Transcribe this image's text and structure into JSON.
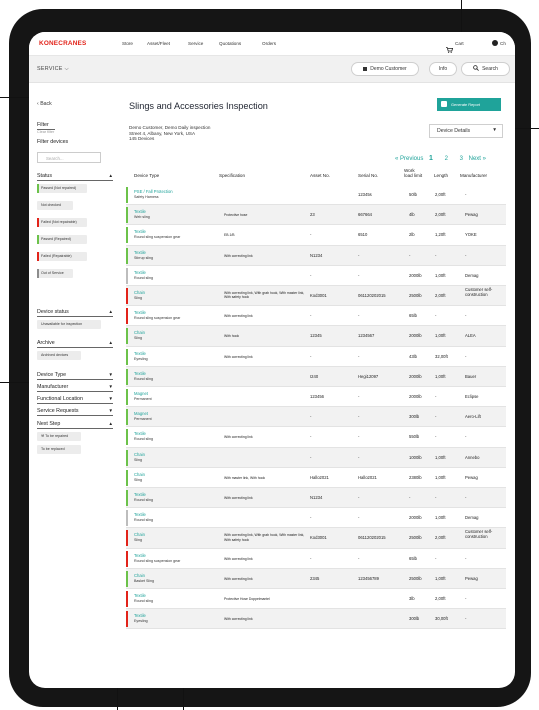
{
  "nav": {
    "logo": "KONECRANES",
    "items": [
      "Store",
      "Asset/Fleet",
      "Service",
      "Quotations",
      "Orders"
    ],
    "cart": "Cart",
    "user": "Ch"
  },
  "subbar": {
    "section": "SERVICE",
    "customer": "Demo Customer",
    "info": "Info",
    "search": "Search"
  },
  "sidebar": {
    "back": "Back",
    "filter": "Filter",
    "clear": "Clear filter",
    "filter_devices": "Filter devices",
    "search_placeholder": "Search...",
    "status_title": "Status",
    "status_chips": [
      {
        "label": "Passed (Not repaired)",
        "color": "#6cc24a"
      },
      {
        "label": "Not checked",
        "color": ""
      },
      {
        "label": "Failed (Not repairable)",
        "color": "#e2231a"
      },
      {
        "label": "Passed (Repaired)",
        "color": "#6cc24a"
      },
      {
        "label": "Failed (Repairable)",
        "color": "#e2231a"
      },
      {
        "label": "Out of Service",
        "color": "#8c8c8c"
      }
    ],
    "device_status_title": "Device status",
    "device_status_chip": "Unavailable for inspection",
    "archive_title": "Archive",
    "archive_chip": "Archived devices",
    "device_type": "Device Type",
    "manufacturer": "Manufacturer",
    "functional_location": "Functional Location",
    "service_requests": "Service Requests",
    "next_step_title": "Next Step",
    "next_step_chips": [
      "To be repaired",
      "To be replaced"
    ]
  },
  "main": {
    "title": "Slings and Accessories Inspection",
    "generate_report": "Generate Report",
    "customer_line": "Demo Customer, Demo Daily inspection",
    "address": "Street 4, Albany, New York, USA",
    "devices_count": "145 Devices",
    "view_select": "Device Details",
    "pager": {
      "prev": "« Previous",
      "pages": [
        "1",
        "2",
        "3"
      ],
      "next": "Next »"
    },
    "columns": {
      "type": "Device Type",
      "spec": "Specification",
      "asset": "Asset No.",
      "serial": "Serial No.",
      "wll": [
        "Work",
        "load limit"
      ],
      "length": "Length",
      "mfr": "Manufacturer"
    },
    "rows": [
      {
        "status": "#6cc24a",
        "type": "PSE / Fall Protection",
        "sub": "Safety Harness",
        "spec": "",
        "asset": "",
        "serial": "12345s",
        "wll": "50lb",
        "len": "2,00ft",
        "mfr": "-"
      },
      {
        "status": "#6cc24a",
        "type": "Textile",
        "sub": "Web sling",
        "spec": "Protective hose",
        "asset": "23",
        "serial": "667664",
        "wll": "4lb",
        "len": "2,00ft",
        "mfr": "Pewag"
      },
      {
        "status": "#6cc24a",
        "type": "Textile",
        "sub": "Round sling suspension gear",
        "spec": "EB.1/B",
        "asset": "-",
        "serial": "6510",
        "wll": "2lb",
        "len": "1,20ft",
        "mfr": "YOKE"
      },
      {
        "status": "#6cc24a",
        "type": "Textile",
        "sub": "Stirrup sling",
        "spec": "With correcting link",
        "asset": "N1234",
        "serial": "-",
        "wll": "-",
        "len": "-",
        "mfr": "-"
      },
      {
        "status": "#bdbdbd",
        "type": "Textile",
        "sub": "Round sling",
        "spec": "",
        "asset": "-",
        "serial": "-",
        "wll": "2000lb",
        "len": "1,00ft",
        "mfr": "Demag"
      },
      {
        "status": "#e2231a",
        "type": "Chain",
        "sub": "Sling",
        "spec": "With correcting link, With grab hook, With master link, With safety hook",
        "asset": "Kod3001",
        "serial": "061120202015",
        "wll": "2500lb",
        "len": "2,00ft",
        "mfr": "Customer self-construction"
      },
      {
        "status": "#e2231a",
        "type": "Textile",
        "sub": "Round sling suspension gear",
        "spec": "With correcting link",
        "asset": "-",
        "serial": "-",
        "wll": "65lb",
        "len": "-",
        "mfr": "-"
      },
      {
        "status": "#6cc24a",
        "type": "Chain",
        "sub": "Sling",
        "spec": "With hook",
        "asset": "12345",
        "serial": "1234567",
        "wll": "2000lb",
        "len": "1,00ft",
        "mfr": "ALEA"
      },
      {
        "status": "#6cc24a",
        "type": "Textile",
        "sub": "Eyesling",
        "spec": "With correcting link",
        "asset": "-",
        "serial": "-",
        "wll": "43lb",
        "len": "32,00ft",
        "mfr": "-"
      },
      {
        "status": "#6cc24a",
        "type": "Textile",
        "sub": "Round sling",
        "spec": "",
        "asset": "I240",
        "serial": "Hegi12097",
        "wll": "2000lb",
        "len": "1,00ft",
        "mfr": "Bauer"
      },
      {
        "status": "#6cc24a",
        "type": "Magnet",
        "sub": "Permanent",
        "spec": "",
        "asset": "123456",
        "serial": "-",
        "wll": "2000lb",
        "len": "-",
        "mfr": "Eclipse"
      },
      {
        "status": "#6cc24a",
        "type": "Magnet",
        "sub": "Permanent",
        "spec": "",
        "asset": "-",
        "serial": "-",
        "wll": "300lb",
        "len": "-",
        "mfr": "Aero-Lift"
      },
      {
        "status": "#6cc24a",
        "type": "Textile",
        "sub": "Round sling",
        "spec": "With correcting link",
        "asset": "-",
        "serial": "-",
        "wll": "550lb",
        "len": "-",
        "mfr": "-"
      },
      {
        "status": "#6cc24a",
        "type": "Chain",
        "sub": "Sling",
        "spec": "",
        "asset": "-",
        "serial": "-",
        "wll": "1000lb",
        "len": "1,00ft",
        "mfr": "Annebo"
      },
      {
        "status": "#6cc24a",
        "type": "Chain",
        "sub": "Sling",
        "spec": "With master link, With hook",
        "asset": "Hallo2021",
        "serial": "Hallo2021",
        "wll": "2380lb",
        "len": "1,00ft",
        "mfr": "Pewag"
      },
      {
        "status": "#6cc24a",
        "type": "Textile",
        "sub": "Round sling",
        "spec": "With correcting link",
        "asset": "N1234",
        "serial": "-",
        "wll": "-",
        "len": "-",
        "mfr": "-"
      },
      {
        "status": "#bdbdbd",
        "type": "Textile",
        "sub": "Round sling",
        "spec": "",
        "asset": "-",
        "serial": "-",
        "wll": "2000lb",
        "len": "1,00ft",
        "mfr": "Demag"
      },
      {
        "status": "#e2231a",
        "type": "Chain",
        "sub": "Sling",
        "spec": "With correcting link, With grab hook, With master link, With safety hook",
        "asset": "Kod3001",
        "serial": "061120202015",
        "wll": "2500lb",
        "len": "2,00ft",
        "mfr": "Customer self-construction"
      },
      {
        "status": "#e2231a",
        "type": "Textile",
        "sub": "Round sling suspension gear",
        "spec": "With correcting link",
        "asset": "-",
        "serial": "-",
        "wll": "65lb",
        "len": "-",
        "mfr": "-"
      },
      {
        "status": "#6cc24a",
        "type": "Chain",
        "sub": "Basket Sling",
        "spec": "With correcting link",
        "asset": "2345",
        "serial": "123456789",
        "wll": "2500lb",
        "len": "1,00ft",
        "mfr": "Pewag"
      },
      {
        "status": "#e2231a",
        "type": "Textile",
        "sub": "Round sling",
        "spec": "Protective Hose Doppelmantel",
        "asset": "",
        "serial": "",
        "wll": "3lb",
        "len": "2,00ft",
        "mfr": "-"
      },
      {
        "status": "#e2231a",
        "type": "Textile",
        "sub": "Eyesling",
        "spec": "With correcting link",
        "asset": "",
        "serial": "",
        "wll": "300lb",
        "len": "30,00ft",
        "mfr": "-"
      }
    ]
  },
  "colors": {
    "accent": "#1fa39a",
    "brand": "#e2231a",
    "pass": "#6cc24a",
    "fail": "#e2231a",
    "neutral": "#8c8c8c"
  },
  "icons": [
    "chevron-down-icon",
    "back-arrow-icon",
    "cart-icon",
    "user-icon",
    "search-icon",
    "document-icon",
    "truck-icon",
    "wrench-icon"
  ]
}
